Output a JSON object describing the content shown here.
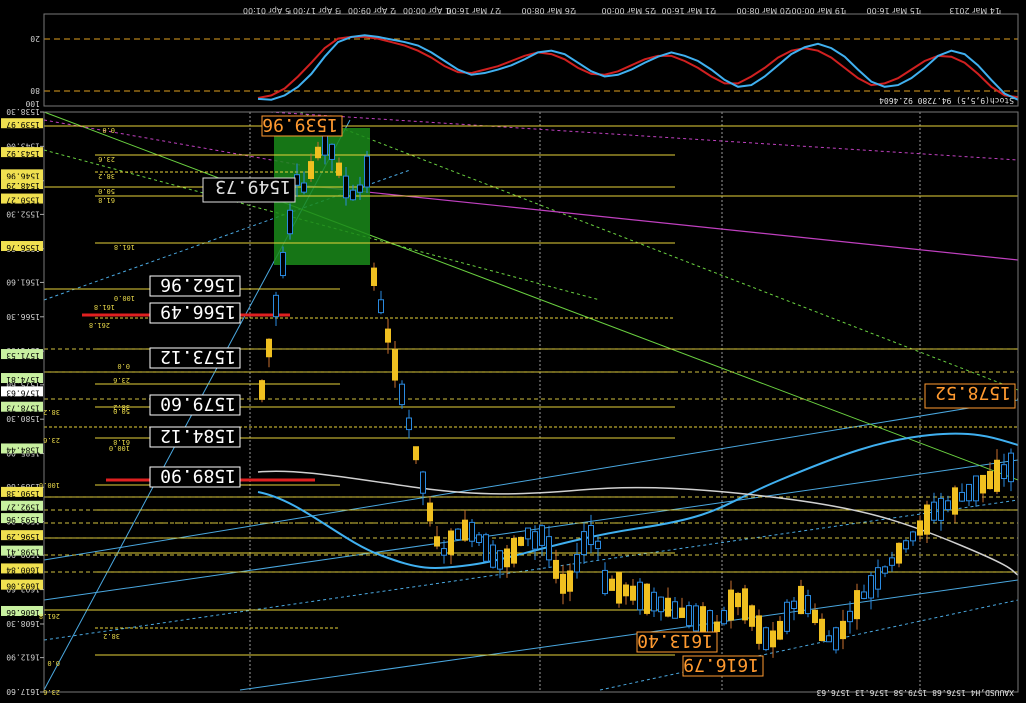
{
  "window": {
    "symbol_header": "XAUUSD,H4  1576.68 1579.58 1576.13 1576.63",
    "indicator_header": "Stoch(9,5,5) 94.7280 92.4604"
  },
  "chart_data": {
    "type": "candlestick",
    "orientation": "rotated-180",
    "price_axis": {
      "ticks": [
        "1538.30",
        "1543.00",
        "1547.70",
        "1552.30",
        "1557.00",
        "1561.60",
        "1566.30",
        "1571.00",
        "1575.60",
        "1580.30",
        "1585.00",
        "1589.60",
        "1594.30",
        "1598.90",
        "1603.60",
        "1608.30",
        "1612.90",
        "1617.60"
      ],
      "highlighted_levels": [
        {
          "label": "1539.97",
          "color": "#f0e050"
        },
        {
          "label": "1543.92",
          "color": "#f0e050"
        },
        {
          "label": "1546.96",
          "color": "#f0e050"
        },
        {
          "label": "1548.29",
          "color": "#f0e050"
        },
        {
          "label": "1550.27",
          "color": "#f0e050"
        },
        {
          "label": "1556.76",
          "color": "#f0e050"
        },
        {
          "label": "1571.53",
          "color": "#c8f0a0"
        },
        {
          "label": "1574.81",
          "color": "#c8f0a0"
        },
        {
          "label": "1576.63",
          "color": "#ffffff"
        },
        {
          "label": "1578.73",
          "color": "#c8f0a0"
        },
        {
          "label": "1584.44",
          "color": "#c8f0a0"
        },
        {
          "label": "1590.38",
          "color": "#f0e050"
        },
        {
          "label": "1592.27",
          "color": "#c8f0a0"
        },
        {
          "label": "1593.96",
          "color": "#c8f0a0"
        },
        {
          "label": "1596.29",
          "color": "#f0e050"
        },
        {
          "label": "1598.41",
          "color": "#c8f0a0"
        },
        {
          "label": "1600.84",
          "color": "#f0e050"
        },
        {
          "label": "1603.06",
          "color": "#f0e050"
        },
        {
          "label": "1606.66",
          "color": "#c8f0a0"
        }
      ]
    },
    "time_axis": {
      "ticks": [
        "14 Mar 2013",
        "15 Mar 16:00",
        "19 Mar 00:00",
        "20 Mar 08:00",
        "21 Mar 16:00",
        "25 Mar 00:00",
        "26 Mar 08:00",
        "27 Mar 16:00",
        "1 Apr 00:00",
        "2 Apr 09:00",
        "3 Apr 17:00",
        "5 Apr 01:00"
      ]
    },
    "callouts": [
      {
        "text": "1539.96",
        "color": "#ff9a30"
      },
      {
        "text": "1549.73",
        "color": "#e0e0e0"
      },
      {
        "text": "1562.96",
        "color": "#ffffff"
      },
      {
        "text": "1566.49",
        "color": "#ffffff"
      },
      {
        "text": "1573.12",
        "color": "#ffffff"
      },
      {
        "text": "1579.60",
        "color": "#ffffff"
      },
      {
        "text": "1584.12",
        "color": "#ffffff"
      },
      {
        "text": "1589.90",
        "color": "#ffffff"
      },
      {
        "text": "1578.52",
        "color": "#ff9a30"
      },
      {
        "text": "1613.40",
        "color": "#ff9a30"
      },
      {
        "text": "1616.79",
        "color": "#ff9a30"
      }
    ],
    "fib_labels": [
      "0.0",
      "23.6",
      "38.2",
      "50.0",
      "61.8",
      "161.8",
      "100.0",
      "261.8",
      "0.0",
      "23.6",
      "38.2",
      "50.0",
      "61.8",
      "100.0",
      "161.8",
      "100.0",
      "38.2",
      "23.6",
      "261.8",
      "0.0",
      "23.6",
      "38.2",
      "423.6"
    ],
    "stochastic": {
      "levels": [
        "20",
        "80"
      ],
      "scale_max": "100",
      "main": [
        95,
        88,
        72,
        55,
        42,
        38,
        44,
        58,
        70,
        78,
        80,
        74,
        60,
        45,
        35,
        30,
        34,
        42,
        55,
        68,
        78,
        80,
        72,
        60,
        50,
        44,
        40,
        45,
        52,
        60,
        66,
        68,
        62,
        52,
        42,
        38,
        40,
        48,
        55,
        60,
        64,
        66,
        60,
        50,
        40,
        32,
        28,
        25,
        22,
        20,
        22,
        28,
        45,
        65,
        80,
        90,
        95,
        94
      ],
      "signal": [
        92,
        90,
        80,
        65,
        52,
        45,
        44,
        50,
        60,
        70,
        76,
        78,
        70,
        58,
        46,
        38,
        35,
        38,
        46,
        58,
        68,
        76,
        76,
        68,
        58,
        50,
        44,
        44,
        48,
        55,
        62,
        66,
        65,
        58,
        48,
        42,
        40,
        44,
        50,
        56,
        60,
        64,
        63,
        56,
        46,
        38,
        32,
        28,
        24,
        22,
        22,
        24,
        35,
        52,
        68,
        82,
        90,
        93
      ]
    }
  }
}
